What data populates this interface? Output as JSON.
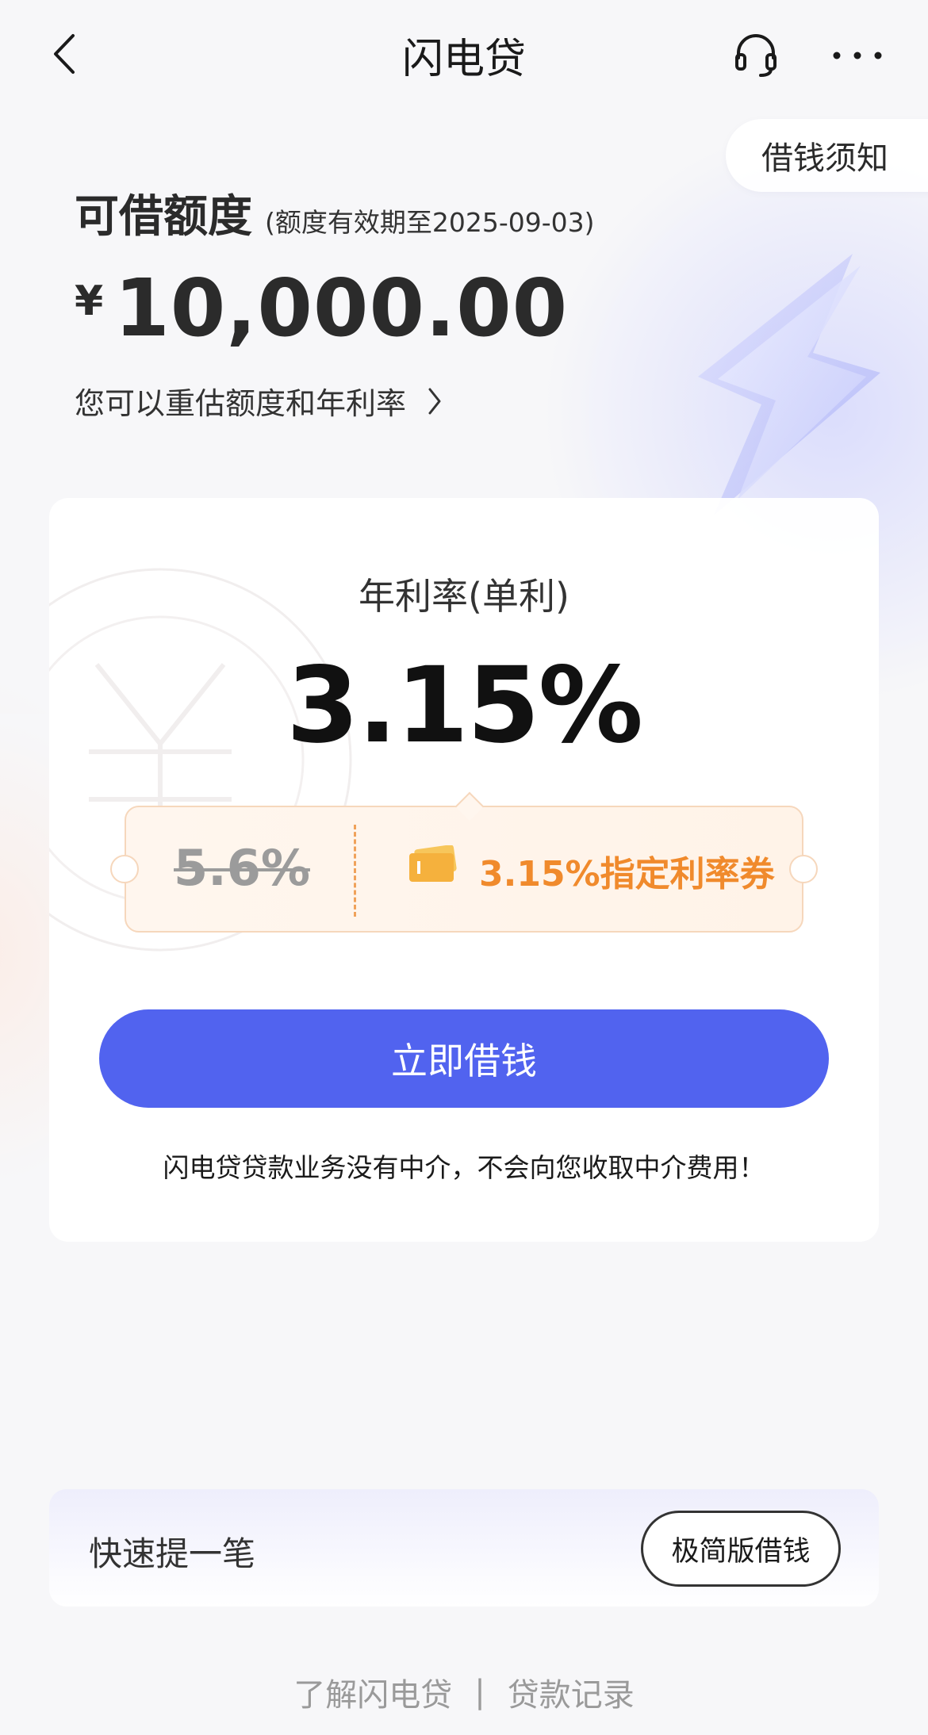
{
  "nav": {
    "title": "闪电贷",
    "icons": {
      "back": "chevron-left-icon",
      "service": "headset-icon",
      "more": "more-icon"
    }
  },
  "notice": {
    "label": "借钱须知"
  },
  "quota": {
    "label": "可借额度",
    "validity": "(额度有效期至2025-09-03)",
    "currency": "¥",
    "amount": "10,000.00",
    "reassess": "您可以重估额度和年利率"
  },
  "rate": {
    "label": "年利率(单利)",
    "value": "3.15%"
  },
  "coupon": {
    "old_rate": "5.6%",
    "text": "3.15%指定利率券"
  },
  "borrow_button": "立即借钱",
  "disclaimer": "闪电贷贷款业务没有中介，不会向您收取中介费用！",
  "quick": {
    "label": "快速提一笔",
    "button": "极简版借钱"
  },
  "footer": {
    "learn": "了解闪电贷",
    "separator": "|",
    "records": "贷款记录"
  },
  "colors": {
    "primary": "#5163ef",
    "coupon_orange": "#f08a2c",
    "coupon_bg": "#fff6ee"
  }
}
